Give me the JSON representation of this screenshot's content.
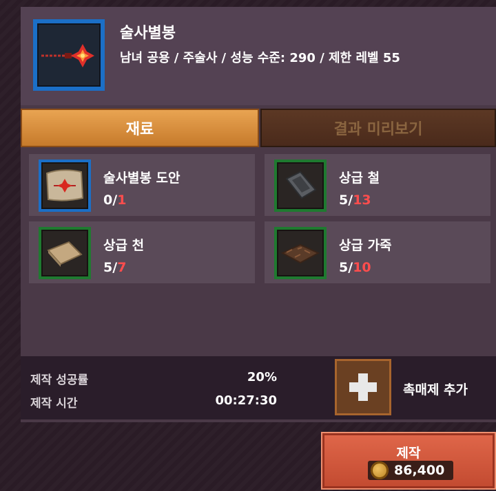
{
  "item": {
    "name": "술사별봉",
    "description": "남녀 공용 / 주술사 / 성능 수준: 290 / 제한 레벨 55",
    "icon": "staff-icon",
    "frame_color": "#1b6fc7"
  },
  "tabs": [
    {
      "label": "재료",
      "active": true
    },
    {
      "label": "결과 미리보기",
      "active": false
    }
  ],
  "materials": [
    {
      "name": "술사별봉 도안",
      "have": "0",
      "need": "1",
      "icon": "scroll-blueprint-icon",
      "rarity_color": "#1b6fc7"
    },
    {
      "name": "상급 철",
      "have": "5",
      "need": "13",
      "icon": "iron-ingot-icon",
      "rarity_color": "#1f7a30"
    },
    {
      "name": "상급 천",
      "have": "5",
      "need": "7",
      "icon": "cloth-icon",
      "rarity_color": "#1f7a30"
    },
    {
      "name": "상급 가죽",
      "have": "5",
      "need": "10",
      "icon": "leather-icon",
      "rarity_color": "#1f7a30"
    }
  ],
  "stats": {
    "success_label": "제작 성공률",
    "success_value": "20%",
    "time_label": "제작 시간",
    "time_value": "00:27:30"
  },
  "catalyst": {
    "label": "촉매제 추가",
    "icon": "plus-icon"
  },
  "craft": {
    "label": "제작",
    "price": "86,400",
    "currency_icon": "gold-coin-icon"
  },
  "colors": {
    "need_shortage": "#ff4d4d",
    "accent_tab": "#e9a452",
    "craft_button": "#d25a3c"
  }
}
